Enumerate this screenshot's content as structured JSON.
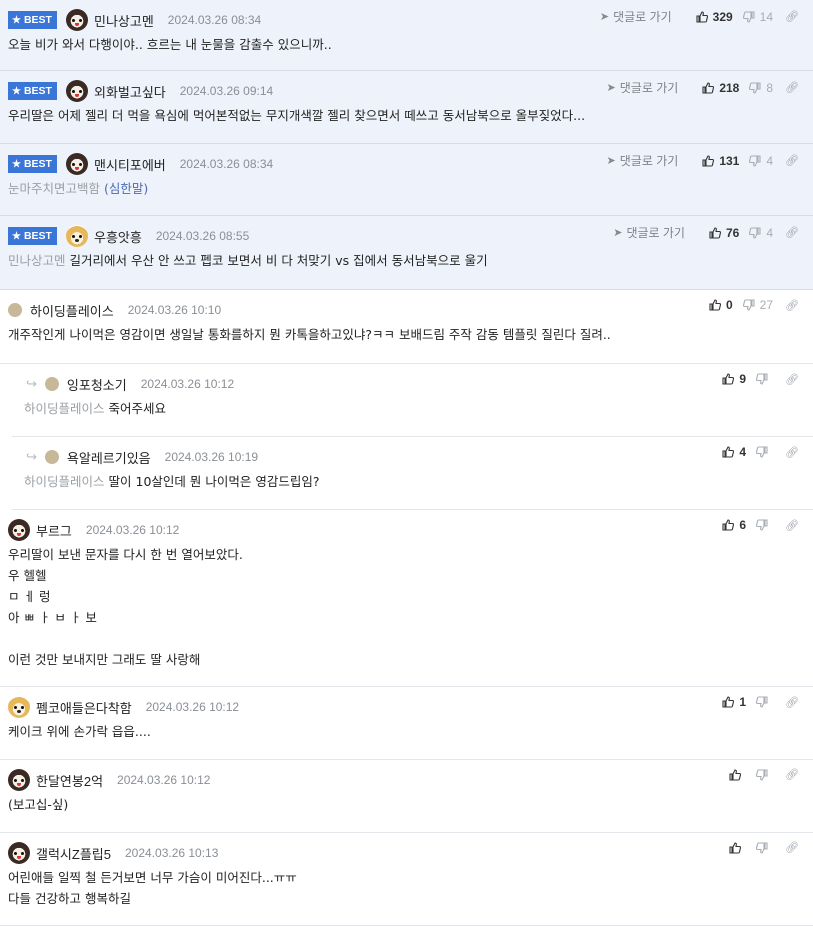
{
  "labels": {
    "best": "BEST",
    "goto_reply": "댓글로 가기"
  },
  "comments": [
    {
      "kind": "best",
      "avatar": "dog-icon",
      "nick": "민나상고멘",
      "date": "2024.03.26 08:34",
      "ref": "",
      "text": "오늘 비가 와서 다행이야.. 흐르는 내 눈물을 감출수 있으니까..",
      "up": "329",
      "down": "14"
    },
    {
      "kind": "best",
      "avatar": "dog-icon",
      "nick": "외화벌고싶다",
      "date": "2024.03.26 09:14",
      "ref": "",
      "text": "우리딸은 어제 젤리 더 먹을 욕심에 먹어본적없는 무지개색깔 젤리 찾으면서 떼쓰고 동서남북으로 올부짖었다...",
      "up": "218",
      "down": "8"
    },
    {
      "kind": "best",
      "avatar": "dog-icon",
      "nick": "맨시티포에버",
      "date": "2024.03.26 08:34",
      "ref": "",
      "text": "눈마주치면고백함",
      "extra": "(심한말)",
      "up": "131",
      "down": "4"
    },
    {
      "kind": "best",
      "avatar": "fox-icon",
      "nick": "우흥앗흥",
      "date": "2024.03.26 08:55",
      "ref": "민나상고멘",
      "text": "길거리에서 우산 안 쓰고 펩코 보면서 비 다 처맞기 vs 집에서 동서남북으로 울기",
      "up": "76",
      "down": "4"
    },
    {
      "kind": "normal",
      "avatar": "plain",
      "nick": "하이딩플레이스",
      "date": "2024.03.26 10:10",
      "ref": "",
      "text": "개주작인게 나이먹은 영감이면 생일날 통화를하지 뭔 카톡을하고있냐?ㅋㅋ 보배드림 주작 감동 템플릿 질린다 질려..",
      "up": "0",
      "down": "27"
    },
    {
      "kind": "reply",
      "avatar": "plain",
      "nick": "잉포청소기",
      "date": "2024.03.26 10:12",
      "ref": "하이딩플레이스",
      "text": "죽어주세요",
      "up": "9",
      "down": ""
    },
    {
      "kind": "reply",
      "avatar": "plain",
      "nick": "욕알레르기있음",
      "date": "2024.03.26 10:19",
      "ref": "하이딩플레이스",
      "text": "딸이 10살인데 뭔 나이먹은 영감드립임?",
      "up": "4",
      "down": ""
    },
    {
      "kind": "normal",
      "avatar": "dog-icon",
      "nick": "부르그",
      "date": "2024.03.26 10:12",
      "ref": "",
      "text": "우리딸이 보낸 문자를 다시 한 번 열어보았다.\n우 헬헬\nㅁ ㅔ 렁\n아 ㅃ ㅏ ㅂ ㅏ 보\n\n이런 것만 보내지만 그래도 딸 사랑해",
      "up": "6",
      "down": ""
    },
    {
      "kind": "normal",
      "avatar": "fox-icon",
      "nick": "펨코애들은다착함",
      "date": "2024.03.26 10:12",
      "ref": "",
      "text": "케이크 위에 손가락 읍읍....",
      "up": "1",
      "down": ""
    },
    {
      "kind": "normal",
      "avatar": "dog-icon",
      "nick": "한달연봉2억",
      "date": "2024.03.26 10:12",
      "ref": "",
      "text": "(보고십-싶)",
      "up": "",
      "down": ""
    },
    {
      "kind": "normal",
      "avatar": "dog-icon",
      "nick": "갤럭시Z플립5",
      "date": "2024.03.26 10:13",
      "ref": "",
      "text": "어린애들 일찍 철 든거보면 너무 가슴이 미어진다...ㅠㅠ\n다들 건강하고 행복하길",
      "up": "",
      "down": ""
    }
  ],
  "colors": {
    "best_bg": "#eef3fb",
    "badge": "#3a75d8",
    "severe": "#4b6bb0"
  }
}
